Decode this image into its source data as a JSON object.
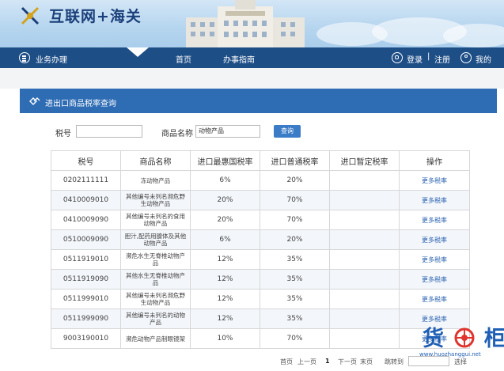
{
  "header": {
    "title": "互联网+海关"
  },
  "nav": {
    "business": "业务办理",
    "home": "首页",
    "guide": "办事指南",
    "login": "登录",
    "separator": "|",
    "register": "注册",
    "mine": "我的"
  },
  "panel": {
    "title": "进出口商品税率查询"
  },
  "search": {
    "tax_no_label": "税号",
    "tax_no_value": "",
    "name_label": "商品名称",
    "name_value": "动物产品",
    "query_label": "查询"
  },
  "table": {
    "headers": [
      "税号",
      "商品名称",
      "进口最惠国税率",
      "进口普通税率",
      "进口暂定税率",
      "操作"
    ],
    "rows": [
      {
        "code": "0202111111",
        "name": "冻动物产品",
        "mfn": "6%",
        "general": "20%",
        "provisional": "",
        "op": "更多税率"
      },
      {
        "code": "0410009010",
        "name": "其他编号未列名濒危野生动物产品",
        "mfn": "20%",
        "general": "70%",
        "provisional": "",
        "op": "更多税率"
      },
      {
        "code": "0410009090",
        "name": "其他编号未列名的食用动物产品",
        "mfn": "20%",
        "general": "70%",
        "provisional": "",
        "op": "更多税率"
      },
      {
        "code": "0510009090",
        "name": "胆汁,配药用腺体及其他动物产品",
        "mfn": "6%",
        "general": "20%",
        "provisional": "",
        "op": "更多税率"
      },
      {
        "code": "0511919010",
        "name": "濒危水生无脊椎动物产品",
        "mfn": "12%",
        "general": "35%",
        "provisional": "",
        "op": "更多税率"
      },
      {
        "code": "0511919090",
        "name": "其他水生无脊椎动物产品",
        "mfn": "12%",
        "general": "35%",
        "provisional": "",
        "op": "更多税率"
      },
      {
        "code": "0511999010",
        "name": "其他编号未列名濒危野生动物产品",
        "mfn": "12%",
        "general": "35%",
        "provisional": "",
        "op": "更多税率"
      },
      {
        "code": "0511999090",
        "name": "其他编号未列名的动物产品",
        "mfn": "12%",
        "general": "35%",
        "provisional": "",
        "op": "更多税率"
      },
      {
        "code": "9003190010",
        "name": "濒危动物产品制眼镜架",
        "mfn": "10%",
        "general": "70%",
        "provisional": "",
        "op": "更多税率"
      }
    ]
  },
  "pager": {
    "first": "首页",
    "prev": "上一页",
    "current": "1",
    "next": "下一页",
    "last": "末页",
    "jump_label": "跳转到",
    "go": "选择"
  },
  "watermark": {
    "text_left": "货",
    "text_right": "柜",
    "url": "www.huozhanggui.net"
  },
  "colors": {
    "nav": "#1e4e86",
    "panel_header": "#2e6cb4",
    "button": "#3c7cc7",
    "link": "#2a62b0"
  }
}
